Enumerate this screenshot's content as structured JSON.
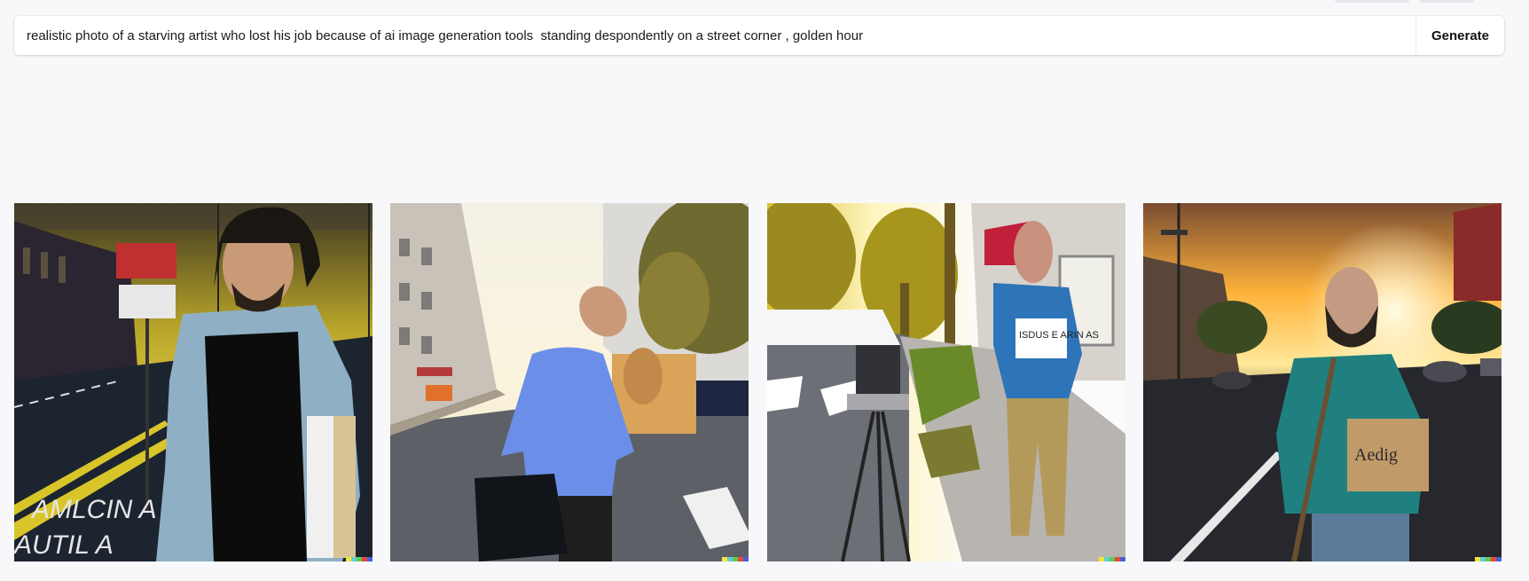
{
  "prompt": {
    "value": "realistic photo of a starving artist who lost his job because of ai image generation tools  standing despondently on a street corner , golden hour",
    "generate_label": "Generate"
  },
  "images": [
    {
      "street_text_1": "AMLCIN A",
      "street_text_2": "AUTIL A"
    },
    {},
    {
      "sign_text": "ISDUS E ARIN AS"
    },
    {
      "sign_text": "Aedig"
    }
  ],
  "colors": {
    "background": "#f8f8fa",
    "bar": "#ffffff",
    "signature": [
      "#f2e53c",
      "#5fd0d8",
      "#61c954",
      "#e44b3c",
      "#4a5fd6"
    ]
  }
}
